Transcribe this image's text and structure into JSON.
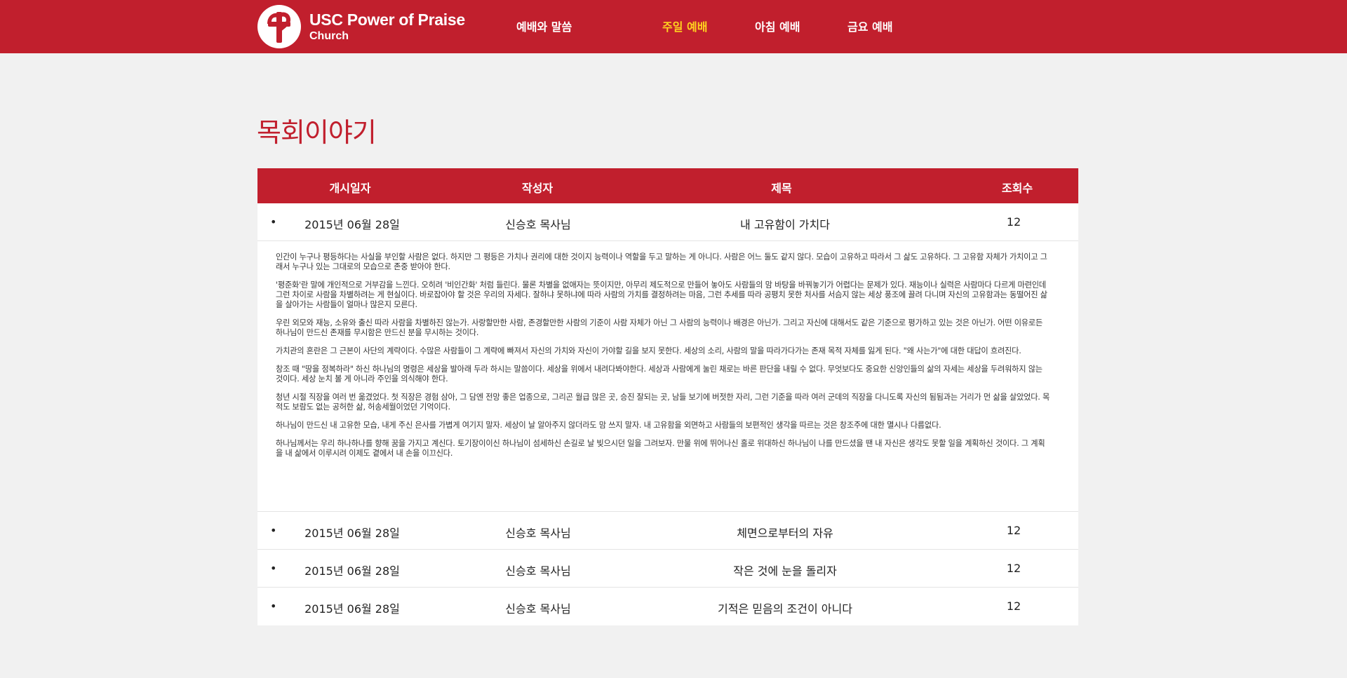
{
  "header": {
    "brand_title": "USC Power of Praise",
    "brand_subtitle": "Church",
    "nav": [
      "예배와 말씀",
      "주일 예배",
      "아침 예배",
      "금요 예배"
    ],
    "active_color": "#ffd21f",
    "accent_color": "#c11f2d"
  },
  "page_title": "목회이야기",
  "board": {
    "columns": [
      "개시일자",
      "작성자",
      "제목",
      "조회수"
    ],
    "rows": [
      {
        "date": "2015년 06월 28일",
        "author": "신승호 목사님",
        "title": "내 고유함이 가치다",
        "views": "12"
      },
      {
        "date": "2015년 06월 28일",
        "author": "신승호 목사님",
        "title": "체면으로부터의 자유",
        "views": "12"
      },
      {
        "date": "2015년 06월 28일",
        "author": "신승호 목사님",
        "title": "작은 것에 눈을 돌리자",
        "views": "12"
      },
      {
        "date": "2015년 06월 28일",
        "author": "신승호 목사님",
        "title": "기적은 믿음의 조건이 아니다",
        "views": "12"
      }
    ],
    "expanded_article": [
      "인간이 누구나 평등하다는 사실을 부인할 사람은 없다. 하지만 그 평등은 가치나 권리에 대한 것이지 능력이나 역할을 두고 말하는 게 아니다. 사람은 어느 둘도 같지 않다. 모습이 고유하고 따라서 그 삶도 고유하다. 그 고유함 자체가 가치이고 그래서 누구나 있는 그대로의 모습으로 존중 받아야 한다.",
      "'평준화'란 말에 개인적으로 거부감을 느낀다. 오히려 '비인간화' 처럼 들린다. 물론 차별을 없애자는 뜻이지만, 아무리 제도적으로 만들어 놓아도 사람들의 맘 바탕을 바꿔놓기가 어렵다는 문제가 있다. 재능이나 실력은 사람마다 다르게 마련인데 그런 차이로 사람을 차별하려는 게 현실이다. 바로잡아야 할 것은 우리의 자세다. 잘하냐 못하냐에 따라 사람의 가치를 결정하려는 마음, 그런 추세를 따라 공평치 못한 처사를 서슴지 않는 세상 풍조에 끌려 다니며 자신의 고유함과는 동떨어진 삶을 살아가는 사람들이 얼마나 많은지 모른다.",
      "우린 외모와 재능, 소유와 출신 따라 사람을 차별하진 않는가. 사랑할만한 사람, 존경할만한 사람의 기준이 사람 자체가 아닌 그 사람의 능력이나 배경은 아닌가. 그리고 자신에 대해서도 같은 기준으로 평가하고 있는 것은 아닌가. 어떤 이유로든 하나님이 만드신 존재를 무시함은 만드신 분을 무시하는 것이다.",
      "가치관의 혼란은 그 근본이 사단의 계략이다. 수많은 사람들이 그 계략에 빠져서 자신의 가치와 자신이 가야할 길을 보지 못한다. 세상의 소리, 사람의 말을 따라가다가는 존재 목적 자체를 잃게 된다. \"왜 사는가\"에 대한 대답이 흐려진다.",
      "창조 때 \"땅을 정복하라\" 하신 하나님의 명령은 세상을 발아래 두라 하시는 말씀이다. 세상을 위에서 내려다봐야한다. 세상과 사람에게 눌린 채로는 바른 판단을 내릴 수 없다. 무엇보다도 중요한 신앙인들의 삶의 자세는 세상을 두려워하지 않는 것이다. 세상 눈치 볼 게 아니라 주인을 의식해야 한다.",
      "청년 시절 직장을 여러 번 옮겼었다. 첫 직장은 경험 삼아, 그 담엔 전망 좋은 업종으로, 그리곤 월급 많은 곳, 승진 잘되는 곳, 남들 보기에 버젓한 자리, 그런 기준을 따라 여러 군데의 직장을 다니도록 자신의 됨됨과는 거리가 먼 삶을 살았었다. 목적도 보람도 없는 공허한 삶, 허송세월이었던 기억이다.",
      "하나님이 만드신 내 고유한 모습, 내게 주신 은사를 가볍게 여기지 말자. 세상이 날 알아주지 않더라도 맘 쓰지 말자. 내 고유함을 외면하고 사람들의 보편적인 생각을 따르는 것은 창조주에 대한 멸시나 다름없다.",
      "하나님께서는 우리 하나하나를 향해 꿈을 가지고 계신다. 토기장이이신 하나님이 섬세하신 손길로 날 빚으시던 일을 그려보자. 만물 위에 뛰어나신 홀로 위대하신 하나님이 나를 만드셨을 땐 내 자신은 생각도 못할 일을 계획하신 것이다. 그 계획을 내 삶에서 이루시려 이제도 곁에서 내 손을 이끄신다."
    ]
  }
}
